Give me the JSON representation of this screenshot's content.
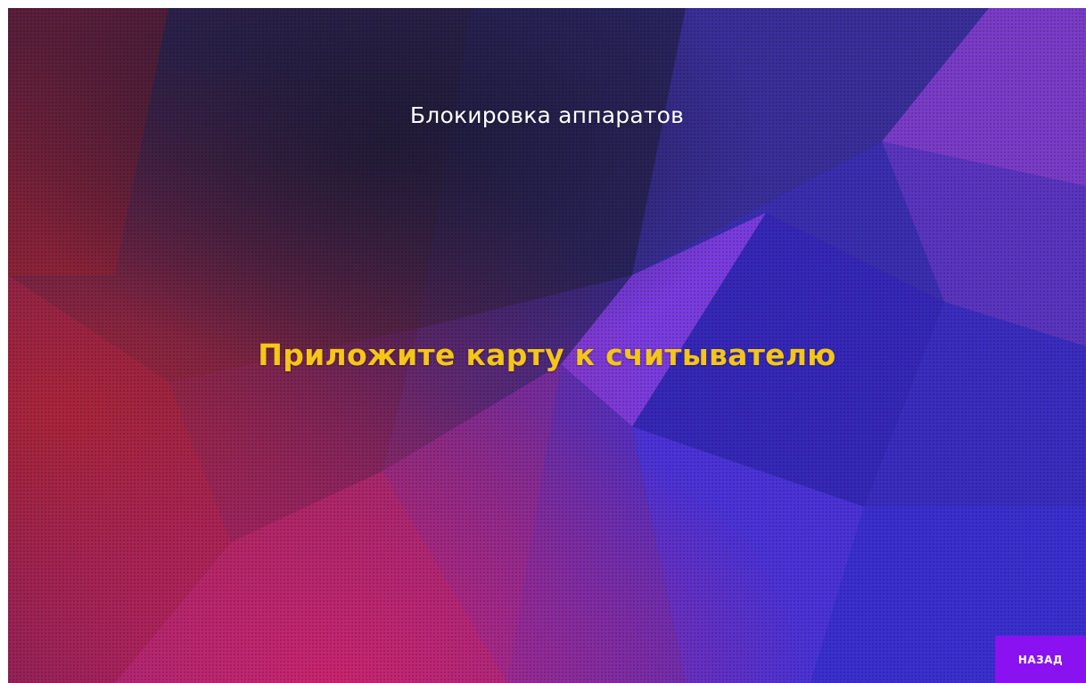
{
  "screen": {
    "title": "Блокировка аппаратов",
    "prompt": "Приложите карту к считывателю"
  },
  "buttons": {
    "back_label": "НАЗАД"
  },
  "colors": {
    "prompt_text": "#f5c518",
    "title_text": "#ffffff",
    "back_button_bg": "#8a12f0"
  }
}
